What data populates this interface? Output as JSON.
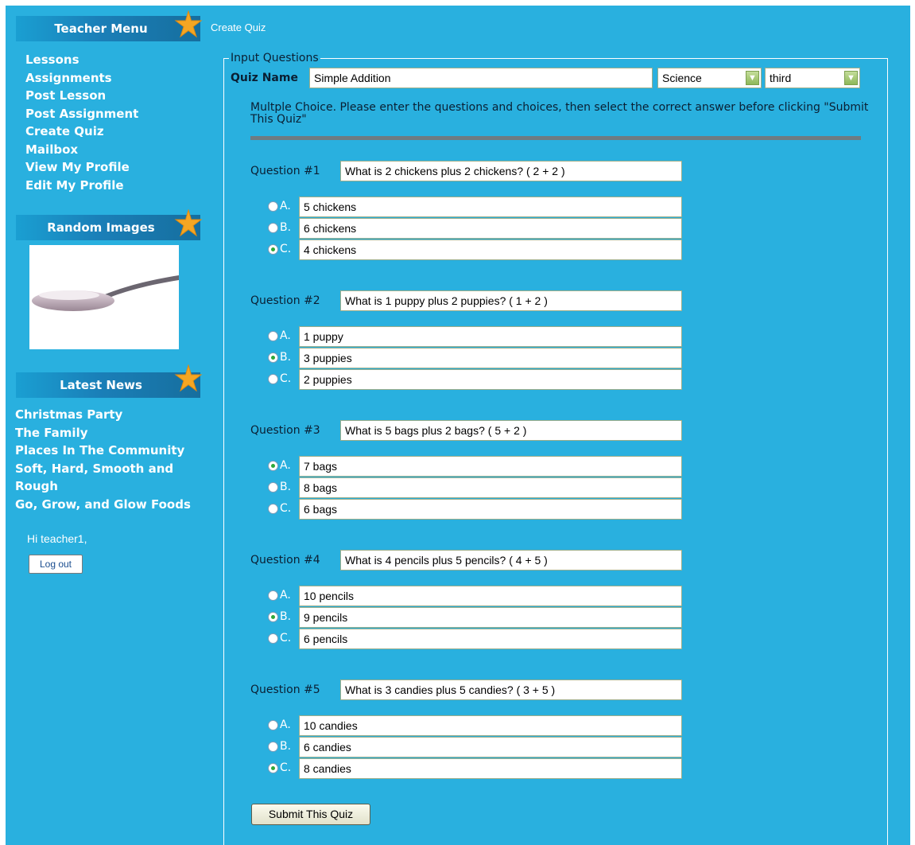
{
  "sidebar": {
    "teacher_menu_title": "Teacher Menu",
    "menu_items": [
      "Lessons",
      "Assignments",
      "Post Lesson",
      "Post Assignment",
      "Create Quiz",
      "Mailbox",
      "View My Profile",
      "Edit My Profile"
    ],
    "random_images_title": "Random Images",
    "random_image_icon": "spoon-image",
    "latest_news_title": "Latest News",
    "news_items": [
      "Christmas Party",
      "The Family",
      "Places In The Community",
      "Soft, Hard, Smooth and Rough",
      "Go, Grow, and Glow Foods"
    ],
    "greeting": "Hi teacher1,",
    "logout_label": "Log out"
  },
  "breadcrumb": "Create Quiz",
  "form": {
    "legend": "Input Questions",
    "quiz_name_label": "Quiz Name",
    "quiz_name_value": "Simple Addition",
    "subject_selected": "Science",
    "grade_selected": "third",
    "instructions": "Multple Choice. Please enter the questions and choices, then select the correct answer before clicking \"Submit This Quiz\"",
    "submit_label": "Submit This Quiz"
  },
  "questions": [
    {
      "label": "Question #1",
      "text": "What is 2 chickens plus 2 chickens? ( 2 + 2 )",
      "correct": 2,
      "choices": [
        {
          "letter": "A.",
          "text": "5 chickens"
        },
        {
          "letter": "B.",
          "text": "6 chickens"
        },
        {
          "letter": "C.",
          "text": "4 chickens"
        }
      ]
    },
    {
      "label": "Question #2",
      "text": "What is 1 puppy plus 2 puppies? ( 1 + 2 )",
      "correct": 1,
      "choices": [
        {
          "letter": "A.",
          "text": "1 puppy"
        },
        {
          "letter": "B.",
          "text": "3 puppies"
        },
        {
          "letter": "C.",
          "text": "2 puppies"
        }
      ]
    },
    {
      "label": "Question #3",
      "text": "What is 5 bags plus 2 bags? ( 5 + 2 )",
      "correct": 0,
      "choices": [
        {
          "letter": "A.",
          "text": "7 bags"
        },
        {
          "letter": "B.",
          "text": "8 bags"
        },
        {
          "letter": "C.",
          "text": "6 bags"
        }
      ]
    },
    {
      "label": "Question #4",
      "text": "What is 4 pencils plus 5 pencils? ( 4 + 5 )",
      "correct": 1,
      "choices": [
        {
          "letter": "A.",
          "text": "10 pencils"
        },
        {
          "letter": "B.",
          "text": "9 pencils"
        },
        {
          "letter": "C.",
          "text": "6 pencils"
        }
      ]
    },
    {
      "label": "Question #5",
      "text": "What is 3 candies plus 5 candies? ( 3 + 5 )",
      "correct": 2,
      "choices": [
        {
          "letter": "A.",
          "text": "10 candies"
        },
        {
          "letter": "B.",
          "text": "6 candies"
        },
        {
          "letter": "C.",
          "text": "8 candies"
        }
      ]
    }
  ],
  "colors": {
    "background": "#29b0df",
    "header": "#1a7fb8",
    "star": "#f5a623",
    "radio_checked": "#2ea83a"
  }
}
